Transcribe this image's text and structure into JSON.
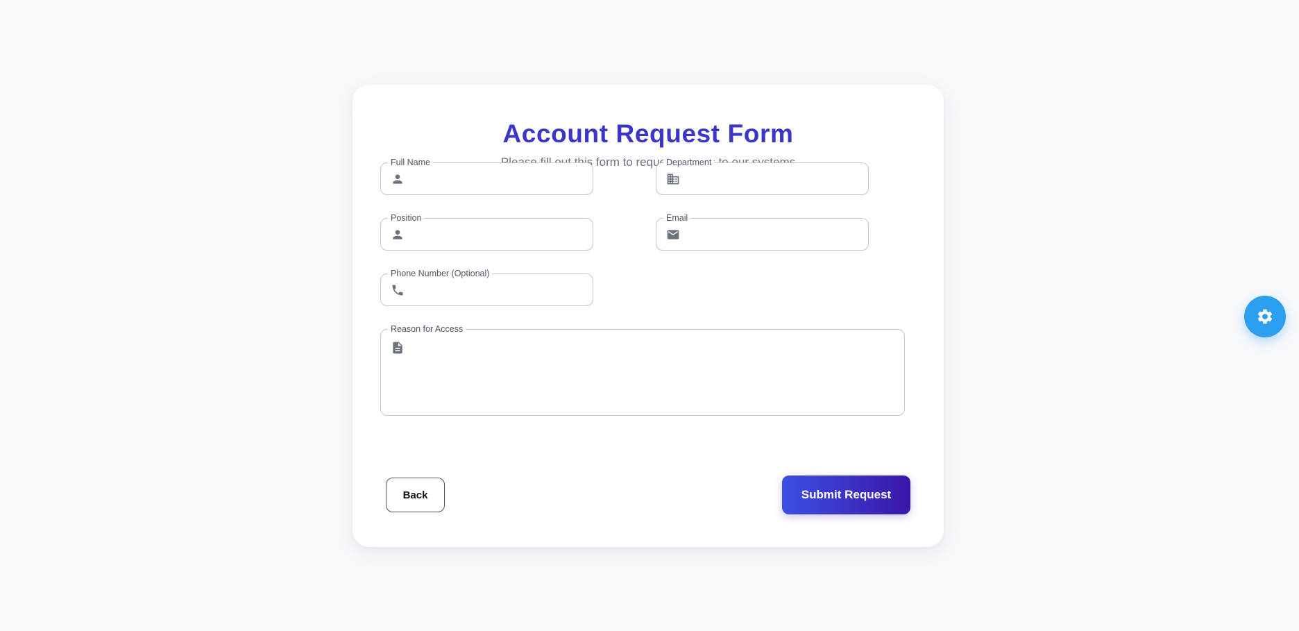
{
  "form": {
    "title": "Account Request Form",
    "subtitle": "Please fill out this form to request access to our systems",
    "fields": {
      "full_name": {
        "label": "Full Name",
        "value": "",
        "icon": "person-icon"
      },
      "department": {
        "label": "Department",
        "value": "",
        "icon": "building-icon"
      },
      "position": {
        "label": "Position",
        "value": "",
        "icon": "person-icon"
      },
      "email": {
        "label": "Email",
        "value": "",
        "icon": "mail-icon"
      },
      "phone": {
        "label": "Phone Number (Optional)",
        "value": "",
        "icon": "phone-icon"
      },
      "reason": {
        "label": "Reason for Access",
        "value": "",
        "icon": "document-icon"
      }
    },
    "back_label": "Back",
    "submit_label": "Submit Request"
  },
  "settings_fab": {
    "icon": "gear-icon"
  },
  "colors": {
    "title": "#3b35c9",
    "subtitle": "#6b7280",
    "submit_gradient_start": "#3d4fe3",
    "submit_gradient_end": "#3a16a8",
    "fab": "#2d9ff0",
    "icon": "#6b7280"
  }
}
